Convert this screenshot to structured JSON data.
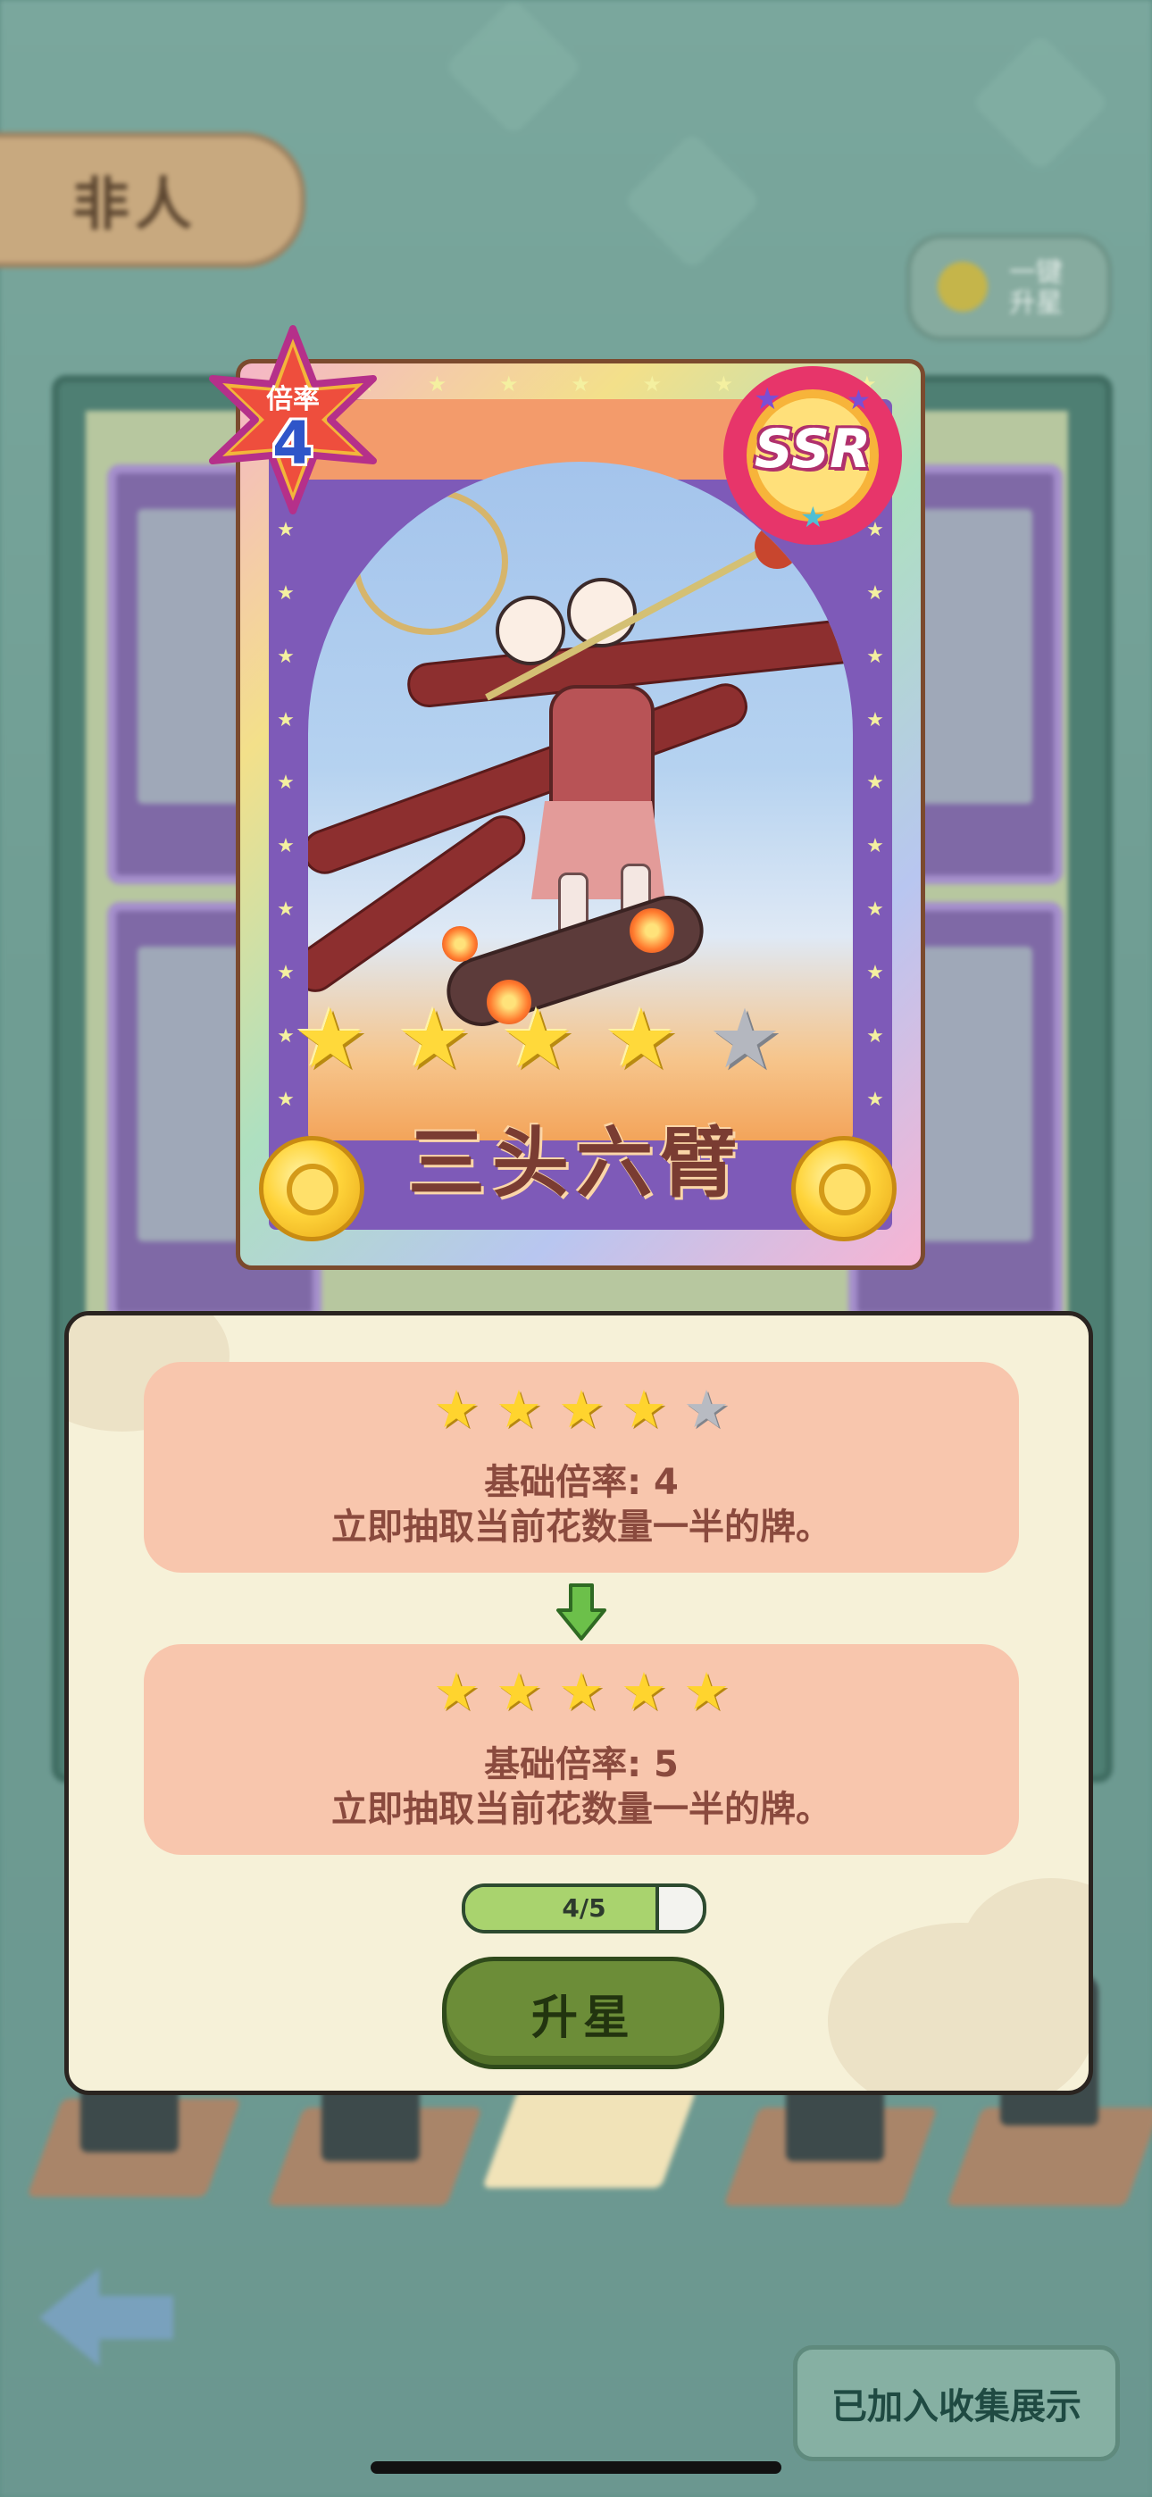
{
  "background": {
    "category_tab_label": "非人",
    "hint_text_line1": "一键",
    "hint_text_line2": "升星"
  },
  "card": {
    "rate_label": "倍率",
    "rate_value": "4",
    "rarity": "SSR",
    "name": "三头六臂",
    "star_rating": {
      "filled": 4,
      "total": 5
    }
  },
  "dialog": {
    "current": {
      "stars_filled": 4,
      "stars_total": 5,
      "line1": "基础倍率: 4",
      "line2": "立即抽取当前花数量一半的牌。"
    },
    "next": {
      "stars_filled": 5,
      "stars_total": 5,
      "line1": "基础倍率: 5",
      "line2": "立即抽取当前花数量一半的牌。"
    },
    "progress": {
      "label": "4/5",
      "fraction": 0.8
    },
    "upgrade_button": "升星"
  },
  "footer": {
    "collect_button": "已加入收集展示"
  },
  "colors": {
    "dialog_bg": "#f6f1d8",
    "info_box": "#f8c6ad",
    "info_text": "#8a4a3e",
    "star_gold": "#ffd42e",
    "star_gray": "#b8bbc2",
    "button_green": "#6c8d38",
    "progress_green": "#a9d36e"
  }
}
